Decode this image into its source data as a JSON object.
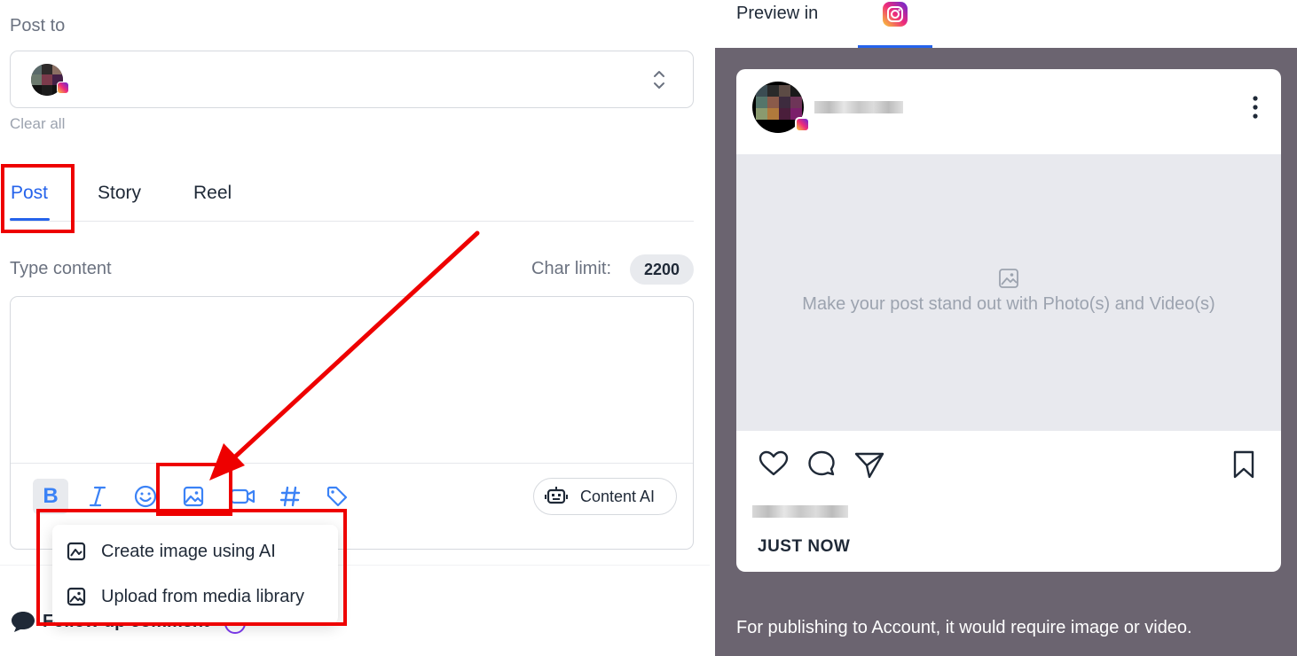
{
  "post_to": {
    "label": "Post to",
    "clear_all": "Clear all"
  },
  "tabs": [
    {
      "label": "Post",
      "active": true
    },
    {
      "label": "Story",
      "active": false
    },
    {
      "label": "Reel",
      "active": false
    }
  ],
  "content": {
    "label": "Type content",
    "char_limit_label": "Char limit:",
    "char_limit_value": "2200",
    "text": ""
  },
  "toolbar": {
    "bold_label": "B",
    "icons": [
      "bold-icon",
      "italic-icon",
      "emoji-icon",
      "image-icon",
      "video-icon",
      "hashtag-icon",
      "tag-icon"
    ],
    "content_ai_label": "Content AI"
  },
  "image_menu": {
    "items": [
      {
        "label": "Create image using AI",
        "icon": "ai-image-icon"
      },
      {
        "label": "Upload from media library",
        "icon": "media-library-icon"
      }
    ]
  },
  "follow_up": {
    "label": "Follow up comment"
  },
  "preview": {
    "label": "Preview in",
    "network_icon": "instagram-icon",
    "media_placeholder": "Make your post stand out with Photo(s) and Video(s)",
    "timestamp": "JUST NOW",
    "publish_note": "For publishing to Account, it would require image or video."
  },
  "colors": {
    "accent": "#2563eb",
    "annotation_red": "#ee0000",
    "preview_background": "#6b6470"
  }
}
